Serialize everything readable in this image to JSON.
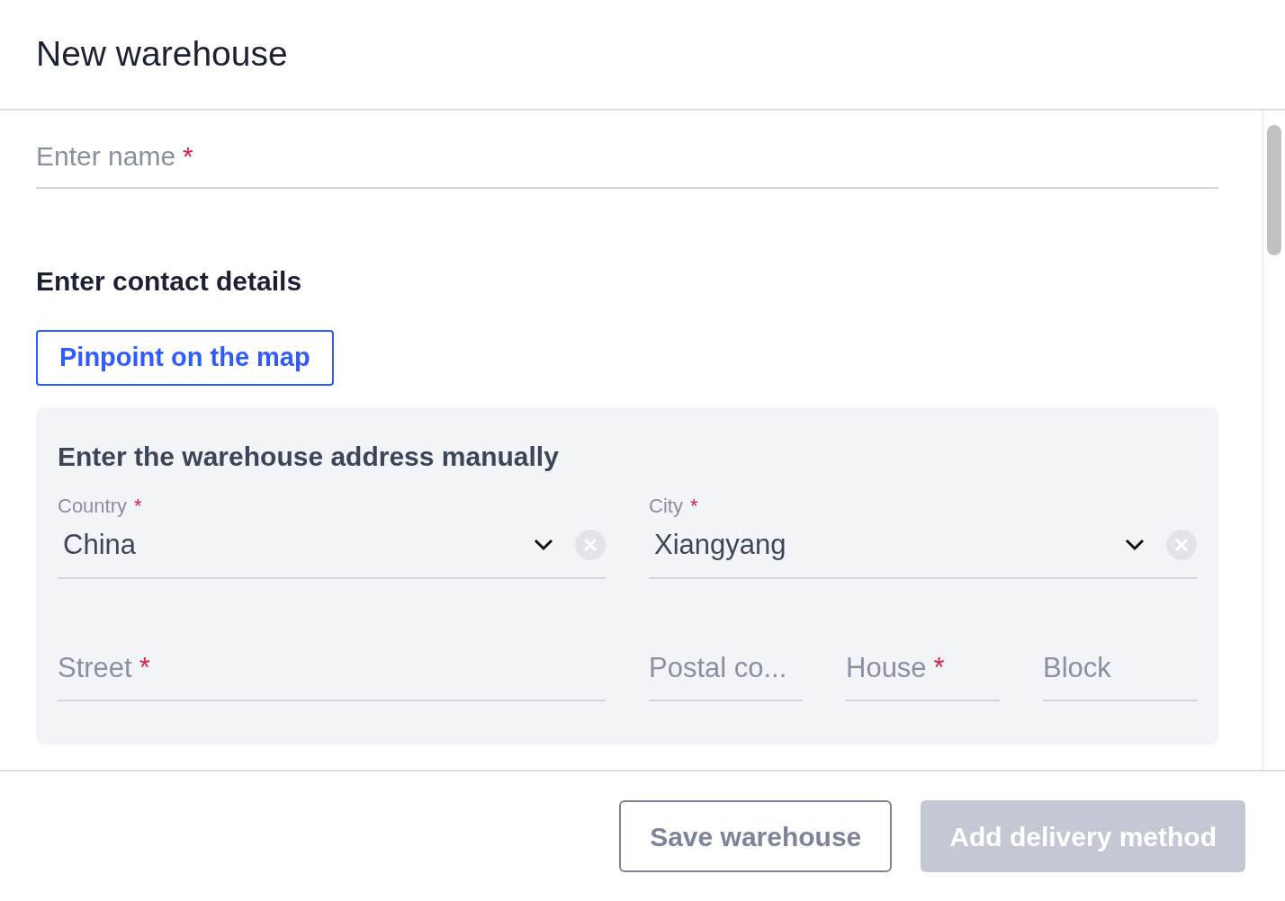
{
  "title": "New warehouse",
  "required_mark": "*",
  "name_field": {
    "placeholder": "Enter name",
    "required": true
  },
  "section_title": "Enter contact details",
  "map_button": "Pinpoint on the map",
  "address_panel": {
    "title": "Enter the warehouse address manually",
    "selects": [
      {
        "label": "Country",
        "required": true,
        "value": "China"
      },
      {
        "label": "City",
        "required": true,
        "value": "Xiangyang"
      }
    ],
    "fields": [
      {
        "placeholder": "Street",
        "required": true
      },
      {
        "placeholder": "Postal co...",
        "required": false
      },
      {
        "placeholder": "House",
        "required": true
      },
      {
        "placeholder": "Block",
        "required": false
      }
    ]
  },
  "buttons": [
    {
      "label": "Save warehouse",
      "disabled": false
    },
    {
      "label": "Add delivery method",
      "disabled": true
    }
  ]
}
